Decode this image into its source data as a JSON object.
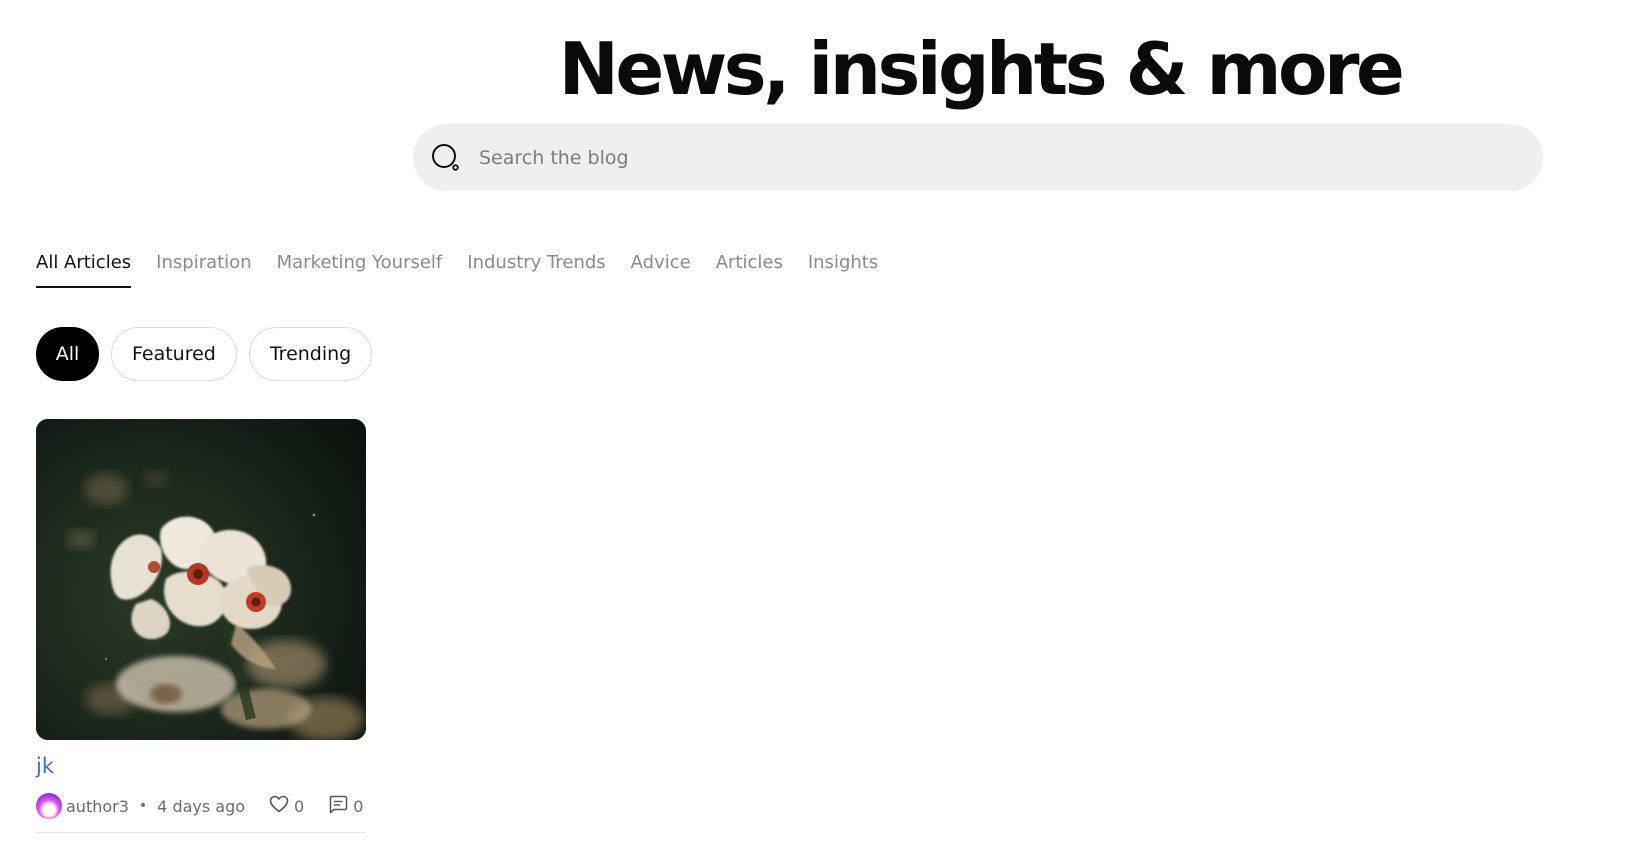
{
  "header": {
    "title": "News, insights & more"
  },
  "search": {
    "placeholder": "Search the blog",
    "icon": "search-icon"
  },
  "category_tabs": [
    {
      "label": "All Articles",
      "active": true
    },
    {
      "label": "Inspiration",
      "active": false
    },
    {
      "label": "Marketing Yourself",
      "active": false
    },
    {
      "label": "Industry Trends",
      "active": false
    },
    {
      "label": "Advice",
      "active": false
    },
    {
      "label": "Articles",
      "active": false
    },
    {
      "label": "Insights",
      "active": false
    }
  ],
  "filters": [
    {
      "label": "All",
      "active": true
    },
    {
      "label": "Featured",
      "active": false
    },
    {
      "label": "Trending",
      "active": false
    }
  ],
  "posts": [
    {
      "title": "jk",
      "author": "author3",
      "separator": "•",
      "time": "4 days ago",
      "likes": "0",
      "comments": "0",
      "image": "white-flowers-photo",
      "title_color": "#3b6fd8"
    }
  ],
  "colors": {
    "active_pill_bg": "#000000",
    "search_bg": "#efefef",
    "link": "#3b6fd8",
    "muted_tab": "#8a8a8a"
  }
}
